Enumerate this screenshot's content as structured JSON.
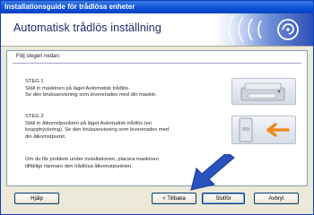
{
  "window": {
    "title": "Installationsguide för trådlösa enheter"
  },
  "header": {
    "title": "Automatisk trådlös inställning",
    "logo_icon": "wireless-signal-icon"
  },
  "content": {
    "instruction": "Följ stegen nedan:",
    "steps": [
      {
        "title": "STEG 1",
        "lines": [
          "Ställ in maskinen på läget Automatisk trådlös.",
          "Se den bruksanvisning som levererades med din maskin."
        ]
      },
      {
        "title": "STEG 2",
        "lines": [
          "Ställ in åtkomstpunkten på läget Automatisk trådlös (en",
          "knapptryckning). Se den bruksanvisning som levererades med",
          "din åtkomstpunkt."
        ]
      }
    ],
    "note_lines": [
      "Om du får problem under installationen, placera maskinen",
      "tillfälligt närmare den trådlösa åtkomstpunkten."
    ]
  },
  "buttons": {
    "help": "Hjälp",
    "back": "< Tillbaka",
    "finish": "Slutför",
    "cancel": "Avbryt"
  },
  "colors": {
    "accent": "#0a50d8",
    "arrow": "#2a52be"
  }
}
